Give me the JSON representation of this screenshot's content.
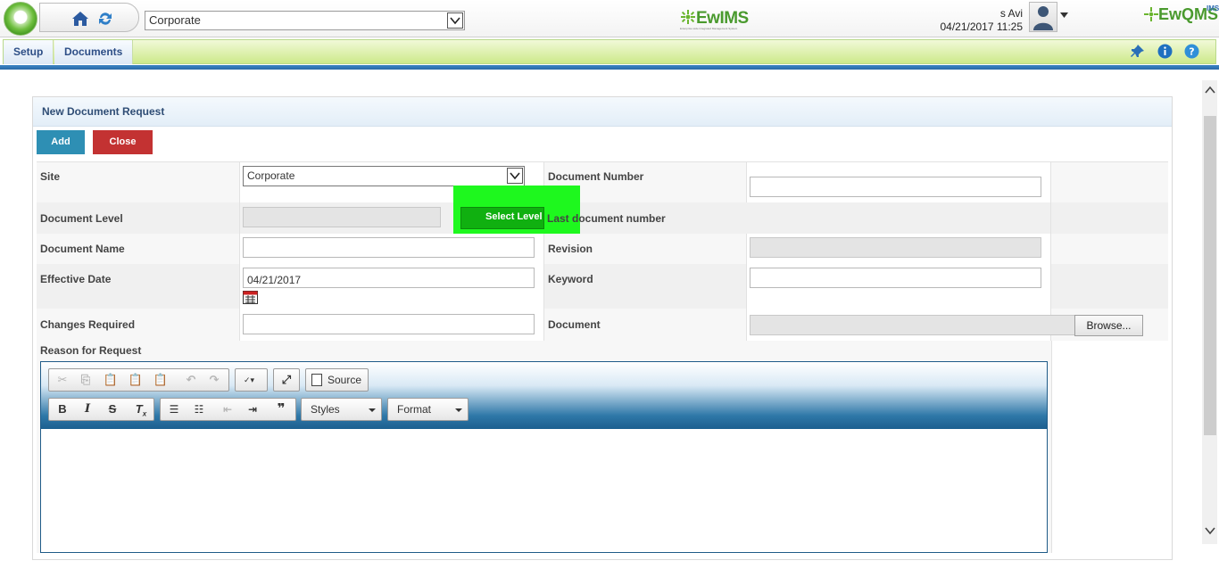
{
  "header": {
    "site_selected": "Corporate",
    "brand_center": "EwIMS",
    "brand_center_tagline": "Enterprise wide Integrated Management System",
    "brand_right": "EwQMS",
    "brand_right_super": "IMS",
    "user_name": "s Avi",
    "datetime": "04/21/2017 11:25"
  },
  "menu": {
    "items": [
      {
        "label": "Setup"
      },
      {
        "label": "Documents"
      }
    ]
  },
  "panel": {
    "title": "New Document Request",
    "add_label": "Add",
    "close_label": "Close"
  },
  "form": {
    "site_label": "Site",
    "site_value": "Corporate",
    "document_number_label": "Document Number",
    "document_number_value": "",
    "document_level_label": "Document Level",
    "document_level_value": "",
    "select_level_label": "Select Level",
    "last_document_number_label": "Last document number",
    "document_name_label": "Document Name",
    "document_name_value": "",
    "revision_label": "Revision",
    "revision_value": "",
    "effective_date_label": "Effective Date",
    "effective_date_value": "04/21/2017",
    "keyword_label": "Keyword",
    "keyword_value": "",
    "changes_required_label": "Changes Required",
    "changes_required_value": "",
    "document_label": "Document",
    "browse_label": "Browse...",
    "reason_label": "Reason for Request"
  },
  "editor": {
    "source_label": "Source",
    "styles_label": "Styles",
    "format_label": "Format"
  },
  "colors": {
    "add_button": "#2e8fb4",
    "close_button": "#c33232",
    "highlight": "#1ef81e",
    "menu_text": "#2d4e86"
  }
}
